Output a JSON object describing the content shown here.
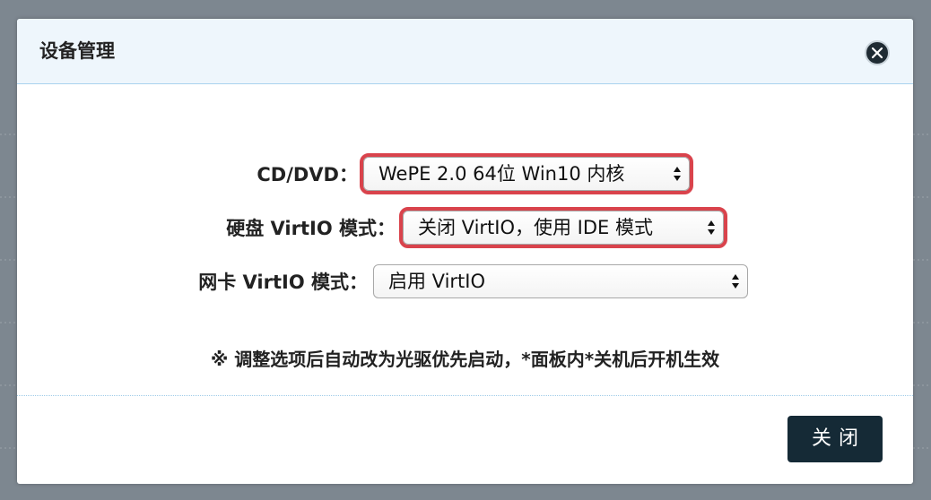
{
  "dialog": {
    "title": "设备管理",
    "close_icon": "close-icon"
  },
  "form": {
    "cd_dvd": {
      "label": "CD/DVD：",
      "value": "WePE 2.0 64位 Win10 内核"
    },
    "disk_virtio": {
      "label": "硬盘 VirtIO 模式：",
      "value": "关闭 VirtIO，使用 IDE 模式"
    },
    "nic_virtio": {
      "label": "网卡 VirtIO 模式：",
      "value": "启用 VirtIO"
    }
  },
  "notice": "※ 调整选项后自动改为光驱优先启动，*面板内*关机后开机生效",
  "footer": {
    "close_label": "关闭"
  },
  "colors": {
    "highlight": "#d9434c",
    "button_bg": "#152a36",
    "header_bg": "#eef6fc"
  }
}
